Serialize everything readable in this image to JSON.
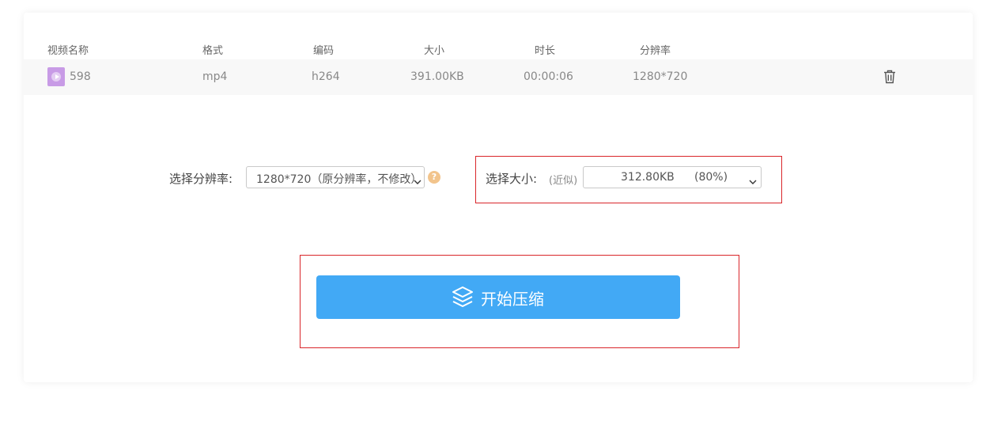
{
  "table": {
    "headers": {
      "name": "视频名称",
      "format": "格式",
      "codec": "编码",
      "size": "大小",
      "duration": "时长",
      "resolution": "分辨率"
    },
    "rows": [
      {
        "name": "598",
        "format": "mp4",
        "codec": "h264",
        "size": "391.00KB",
        "duration": "00:00:06",
        "resolution": "1280*720"
      }
    ]
  },
  "settings": {
    "resolution_label": "选择分辨率:",
    "resolution_value": "1280*720（原分辨率，不修改）",
    "help_glyph": "?",
    "size_label": "选择大小:",
    "size_hint": "(近似)",
    "size_value": "312.80KB",
    "size_percent": "(80%)"
  },
  "action": {
    "compress_label": "开始压缩"
  },
  "colors": {
    "button": "#42a9f5",
    "highlight_border": "#d9262a",
    "thumbnail": "#c89be6",
    "help_icon": "#f2c48c"
  },
  "icons": {
    "thumbnail": "video-play-icon",
    "delete": "trash-icon",
    "help": "question-mark-icon",
    "compress": "layers-icon",
    "dropdown": "chevron-down-icon"
  }
}
